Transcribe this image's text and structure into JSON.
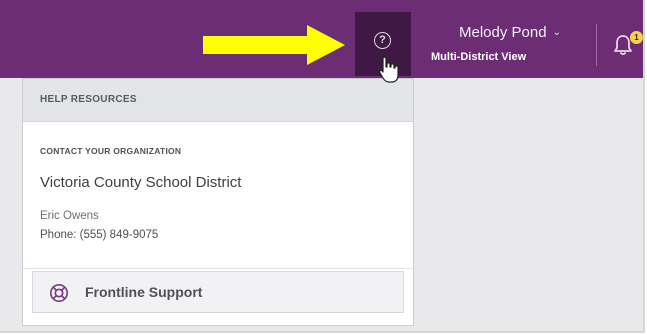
{
  "header": {
    "user_name": "Melody Pond",
    "user_caret": "⌄",
    "view_label": "Multi-District View",
    "help_glyph": "?",
    "notification_count": "1"
  },
  "help_panel": {
    "title": "HELP RESOURCES",
    "contact_heading": "CONTACT YOUR ORGANIZATION",
    "organization_name": "Victoria County School District",
    "contact_name": "Eric Owens",
    "phone": "Phone: (555) 849-9075",
    "support_link": "Frontline Support"
  },
  "colors": {
    "topbar": "#6c2d74",
    "help_button_active": "#3f1844",
    "annotation_arrow": "#ffff00",
    "badge": "#f3d44a",
    "support_icon": "#7b3f86"
  },
  "icons": {
    "help": "question-circle-icon",
    "user_menu": "chevron-down-icon",
    "notifications": "bell-icon",
    "support": "lifebuoy-icon",
    "pointer": "hand-cursor-icon",
    "annotation": "right-arrow-annotation"
  }
}
